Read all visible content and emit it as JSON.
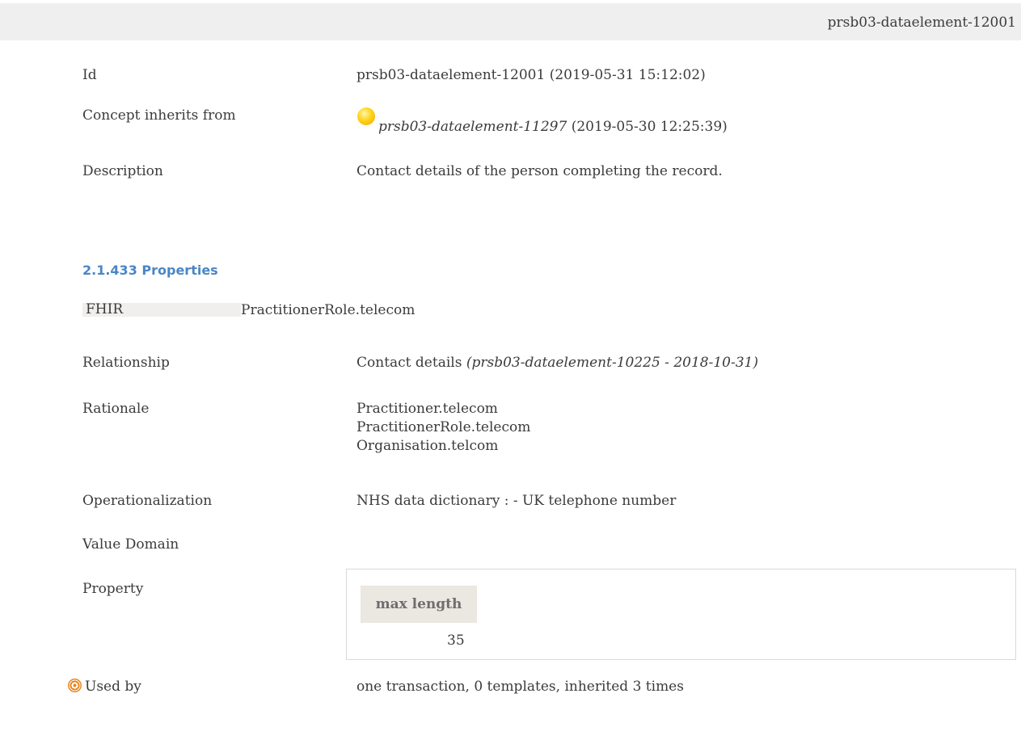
{
  "header": {
    "id": "prsb03-dataelement-12001"
  },
  "concept": {
    "id_label": "Id",
    "id_value": "prsb03-dataelement-12001 (2019-05-31 15:12:02)",
    "inherits_label": "Concept inherits from",
    "inherits_ref": "prsb03-dataelement-11297",
    "inherits_date": "(2019-05-30 12:25:39)",
    "description_label": "Description",
    "description_value": "Contact details of the person completing the record."
  },
  "properties": {
    "section_title": "2.1.433 Properties",
    "fhir_label": "FHIR",
    "fhir_value": "PractitionerRole.telecom",
    "relationship_label": "Relationship",
    "relationship_value": "Contact details",
    "relationship_ref": "(prsb03-dataelement-10225 - 2018-10-31)",
    "rationale_label": "Rationale",
    "rationale_lines": [
      "Practitioner.telecom",
      "PractitionerRole.telecom",
      "Organisation.telcom"
    ],
    "operationalization_label": "Operationalization",
    "operationalization_value": "NHS data dictionary : - UK telephone number",
    "value_domain_label": "Value Domain",
    "property_label": "Property",
    "property_header": "max length",
    "property_value": "35",
    "used_by_label": "Used by",
    "used_by_value": "one transaction, 0 templates, inherited 3 times"
  },
  "icons": {
    "inherits": "lightbulb-icon",
    "used_by": "target-icon"
  },
  "colors": {
    "section_title": "#4a86c5",
    "header_bg": "#efefef",
    "label_bg": "#f1efeb",
    "table_header_bg": "#ebe7e1",
    "icon_orange": "#e8831a"
  }
}
